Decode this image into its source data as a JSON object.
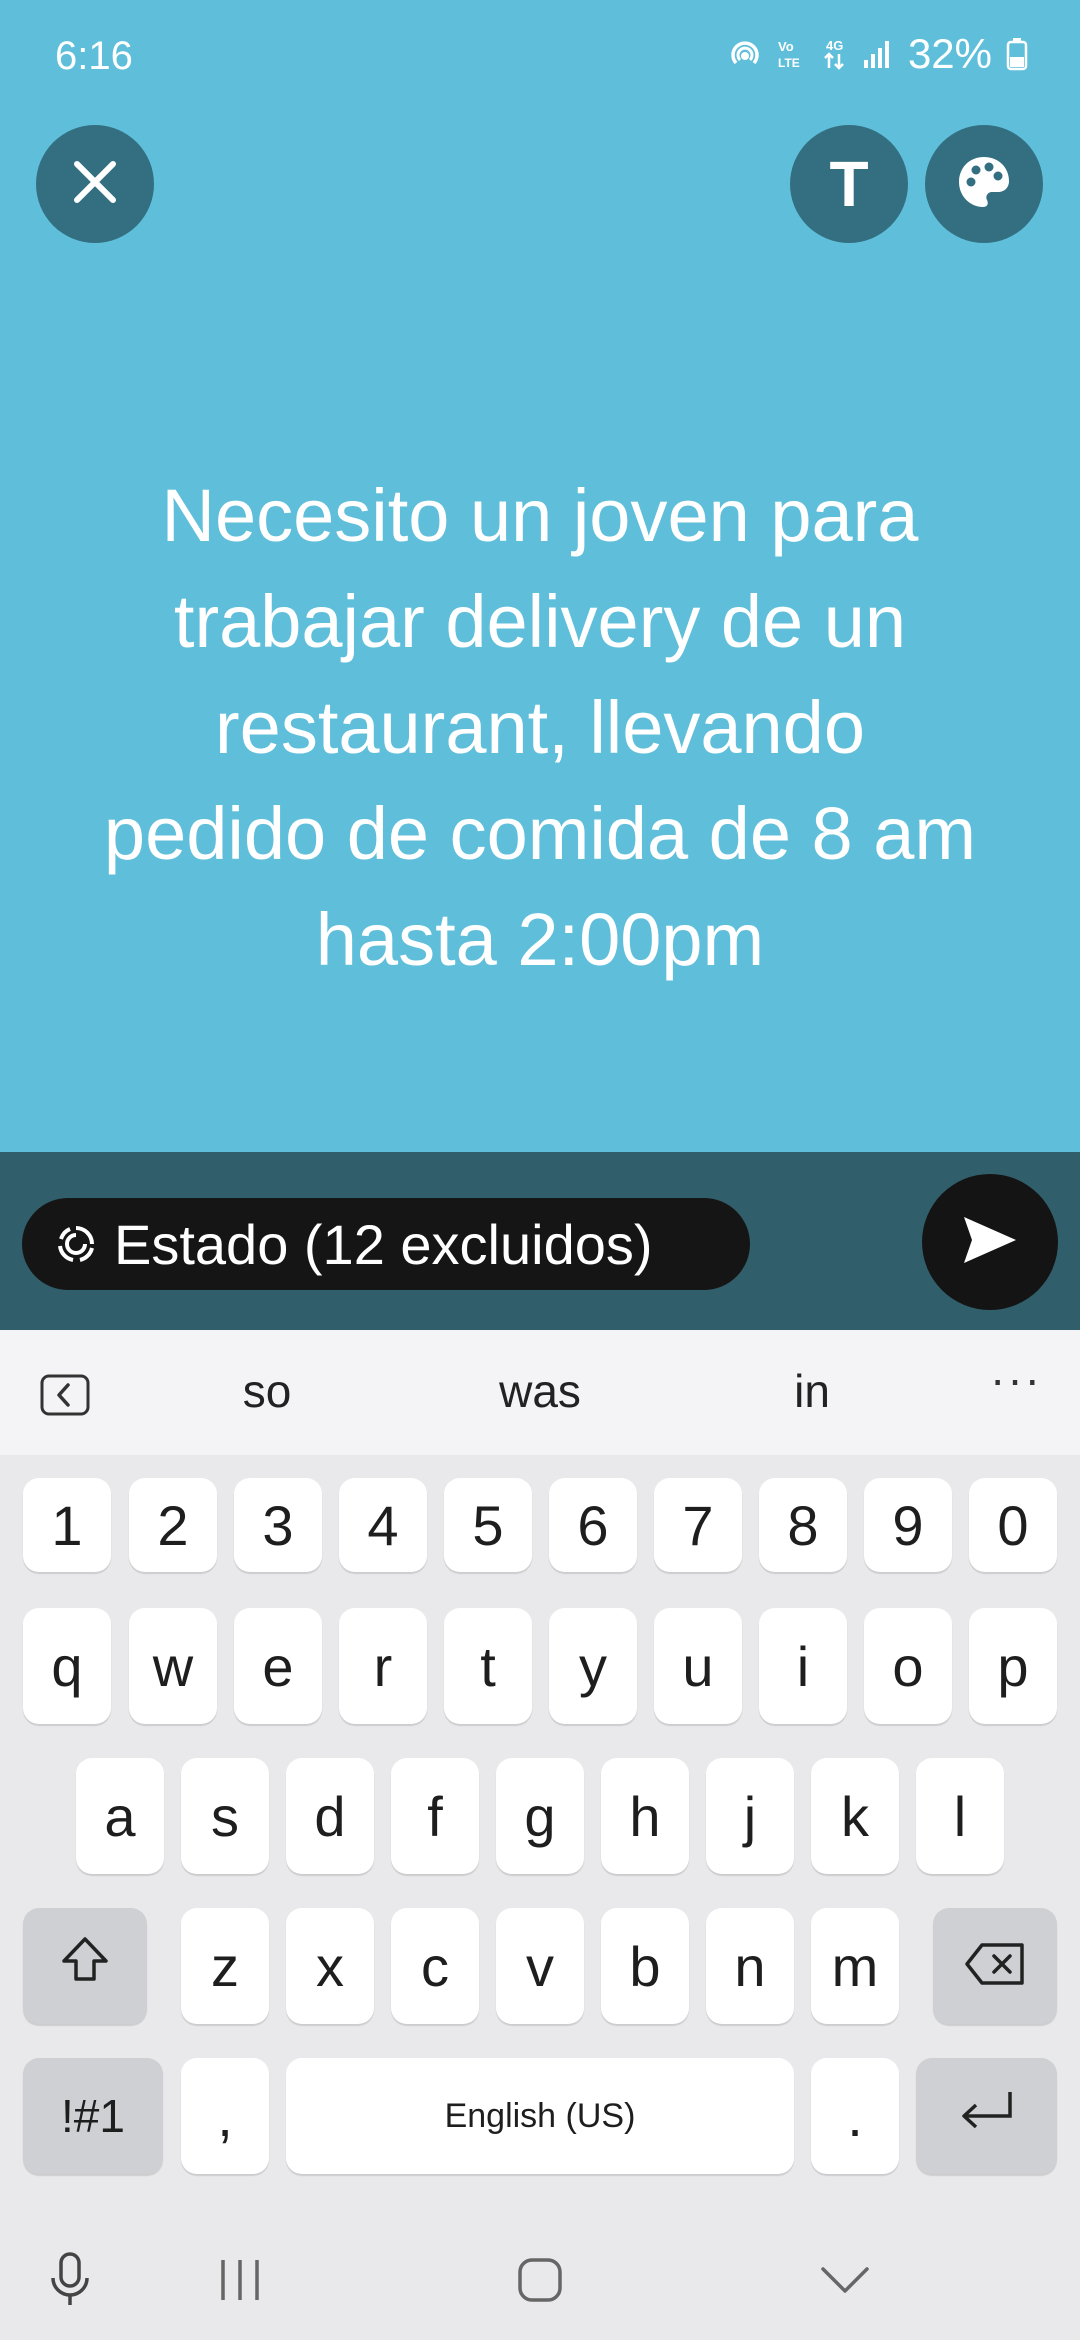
{
  "status_bar": {
    "time": "6:16",
    "battery": "32%",
    "icons": [
      "hotspot-icon",
      "volte-icon",
      "4g-data-icon",
      "signal-icon",
      "battery-icon"
    ]
  },
  "toolbar": {
    "close_icon": "close-icon",
    "text_button_label": "T",
    "palette_icon": "palette-icon"
  },
  "compose": {
    "background_color": "#5fbfdb",
    "lines": [
      "Necesito un joven para",
      "trabajar delivery de un",
      "restaurant,  llevando",
      "pedido de comida de 8 am",
      "hasta 2:00pm"
    ]
  },
  "send_bar": {
    "audience_label": "Estado (12 excluidos)",
    "send_icon": "send-icon"
  },
  "keyboard": {
    "suggestions": [
      "so",
      "was",
      "in"
    ],
    "more": "···",
    "row_numbers": [
      "1",
      "2",
      "3",
      "4",
      "5",
      "6",
      "7",
      "8",
      "9",
      "0"
    ],
    "row_1": [
      "q",
      "w",
      "e",
      "r",
      "t",
      "y",
      "u",
      "i",
      "o",
      "p"
    ],
    "row_2": [
      "a",
      "s",
      "d",
      "f",
      "g",
      "h",
      "j",
      "k",
      "l"
    ],
    "row_3": [
      "z",
      "x",
      "c",
      "v",
      "b",
      "n",
      "m"
    ],
    "symbols_label": "!#1",
    "comma": ",",
    "space_label": "English (US)",
    "period": "."
  },
  "nav_bar": {
    "items": [
      "mic-icon",
      "recents-icon",
      "home-icon",
      "hide-keyboard-icon"
    ]
  }
}
